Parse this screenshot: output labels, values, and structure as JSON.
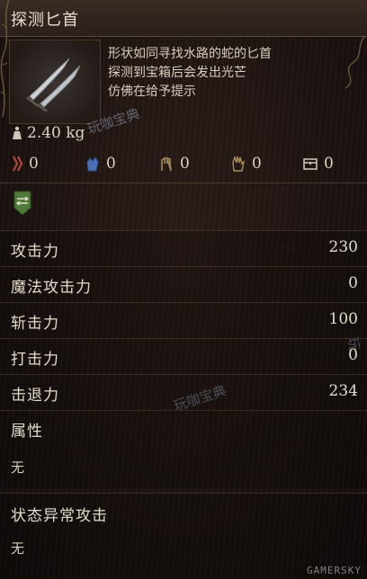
{
  "item": {
    "name": "探测匕首",
    "description": [
      "形状如同寻找水路的蛇的匕首",
      "探测到宝箱后会发出光芒",
      "仿佛在给予提示"
    ],
    "weight": "2.40 kg"
  },
  "resistances": [
    {
      "icon": "slash-resist-icon",
      "value": "0",
      "color": "#b3473a"
    },
    {
      "icon": "blue-hand-icon",
      "value": "0",
      "color": "#4a6fb5"
    },
    {
      "icon": "fist-icon",
      "value": "0",
      "color": "#a88a5a"
    },
    {
      "icon": "palm-icon",
      "value": "0",
      "color": "#a88a5a"
    },
    {
      "icon": "chest-icon",
      "value": "0",
      "color": "#c9c2b2"
    }
  ],
  "skill_badge_icon": "green-shield-icon",
  "stats": [
    {
      "label": "攻击力",
      "value": "230"
    },
    {
      "label": "魔法攻击力",
      "value": "0"
    },
    {
      "label": "斩击力",
      "value": "100"
    },
    {
      "label": "打击力",
      "value": "0"
    },
    {
      "label": "击退力",
      "value": "234"
    }
  ],
  "attribute": {
    "label": "属性",
    "value": "无"
  },
  "status_attack": {
    "label": "状态异常攻击",
    "value": "无"
  },
  "watermarks": [
    "玩咖宝典",
    "玩咖宝典",
    "玩"
  ],
  "footer": "GAMERSKY"
}
